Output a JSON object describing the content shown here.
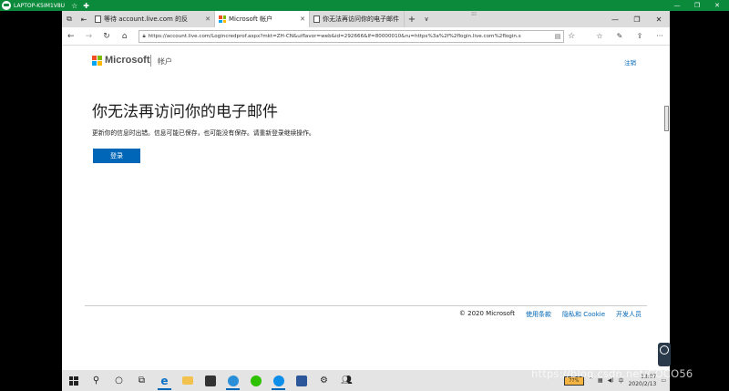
{
  "outer": {
    "host": "LAPTOP-K5IM1V8U",
    "star": "☆",
    "plus": "✚",
    "minimize": "—",
    "restore": "❐",
    "close": "✕"
  },
  "browser": {
    "tabs": [
      {
        "label": "等待 account.live.com 的反",
        "favicon": "page-icon"
      },
      {
        "label": "Microsoft 帐户",
        "favicon": "microsoft-icon",
        "active": true
      },
      {
        "label": "你无法再访问你的电子邮件",
        "favicon": "page-icon"
      }
    ],
    "url": "https://account.live.com/Logincredprof.aspx?mkt=ZH-CN&uiflavor=web&id=292666&lf=80000010&ru=https%3a%2f%2flogin.live.com%2flogin.s",
    "window_controls": {
      "minimize": "—",
      "restore": "❐",
      "close": "✕"
    }
  },
  "page": {
    "brand": "Microsoft",
    "account_label": "帐户",
    "signout": "注销",
    "heading": "你无法再访问你的电子邮件",
    "message": "更新你的信息时出错。信息可能已保存，也可能没有保存。请重新登录继续操作。",
    "signin_button": "登录",
    "footer": {
      "copyright": "© 2020 Microsoft",
      "terms": "使用条款",
      "privacy": "隐私和 Cookie",
      "developers": "开发人员"
    }
  },
  "taskbar": {
    "battery": "77%",
    "time": "13:07",
    "date": "2020/2/13",
    "ime": "中"
  },
  "watermark": "https://blog.csdn.net/COCO56",
  "colors": {
    "accent": "#0067b8",
    "outer_bar": "#0c8a3c",
    "ms_red": "#f25022",
    "ms_green": "#7fba00",
    "ms_blue": "#00a4ef",
    "ms_yellow": "#ffb900"
  }
}
